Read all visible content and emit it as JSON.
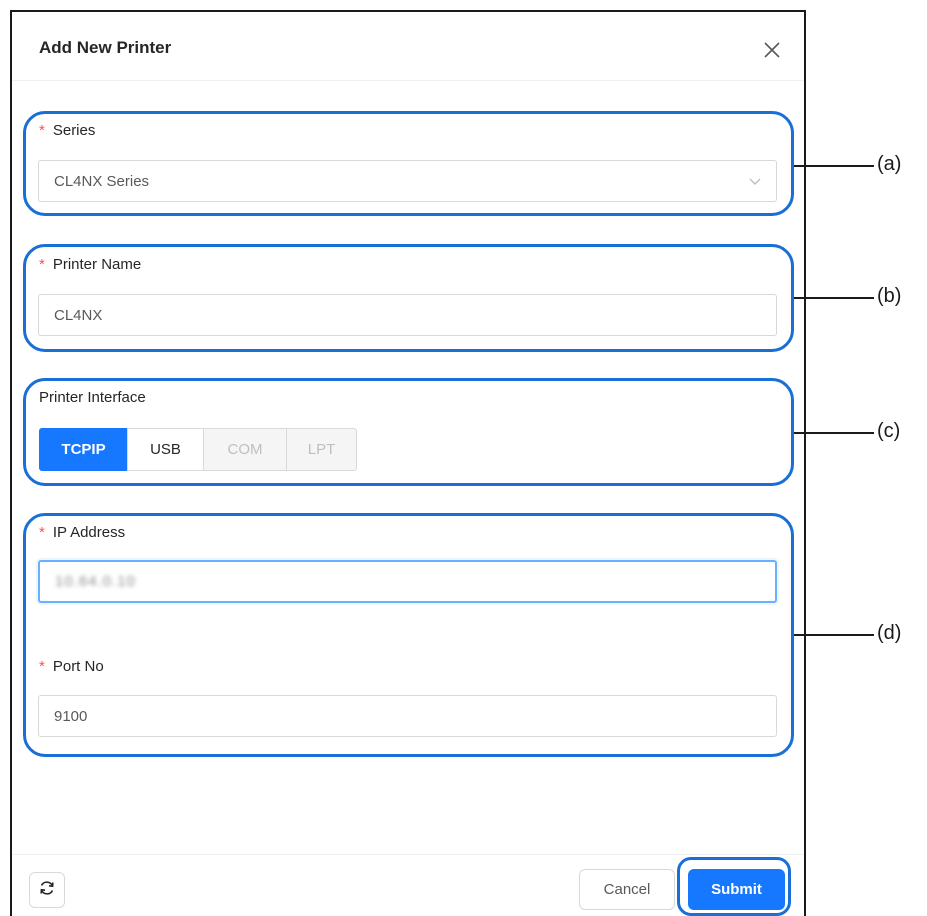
{
  "dialog": {
    "title": "Add New Printer",
    "close_icon": "close-icon"
  },
  "form": {
    "series": {
      "label": "Series",
      "required": true,
      "value": "CL4NX Series"
    },
    "printer_name": {
      "label": "Printer Name",
      "required": true,
      "value": "CL4NX"
    },
    "printer_interface": {
      "label": "Printer Interface",
      "options": [
        {
          "label": "TCPIP",
          "state": "selected"
        },
        {
          "label": "USB",
          "state": "enabled"
        },
        {
          "label": "COM",
          "state": "disabled"
        },
        {
          "label": "LPT",
          "state": "disabled"
        }
      ]
    },
    "ip_address": {
      "label": "IP Address",
      "required": true,
      "value": "10.64.0.10",
      "obscured": true
    },
    "port_no": {
      "label": "Port No",
      "required": true,
      "value": "9100"
    }
  },
  "footer": {
    "refresh_icon": "refresh-icon",
    "cancel_label": "Cancel",
    "submit_label": "Submit"
  },
  "annotations": [
    "(a)",
    "(b)",
    "(c)",
    "(d)"
  ],
  "colors": {
    "primary": "#1677ff",
    "callout": "#1a6fd6",
    "required": "#ff4d4f"
  }
}
